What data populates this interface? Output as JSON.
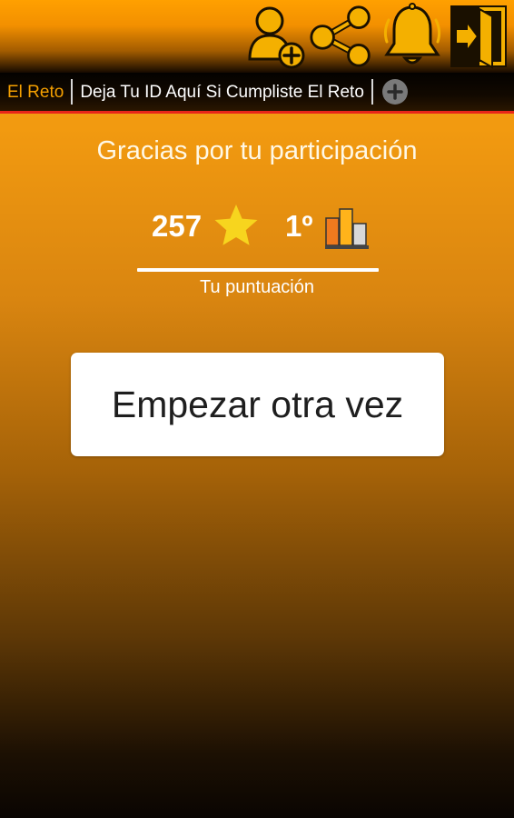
{
  "toolbar": {
    "icons": [
      "add-user-icon",
      "share-icon",
      "bell-icon",
      "exit-icon"
    ],
    "accent_color": "#f5a000"
  },
  "tabs": [
    {
      "label": "El Reto",
      "active": true
    },
    {
      "label": "Deja Tu ID Aquí Si Cumpliste El Reto",
      "active": false
    }
  ],
  "result": {
    "thanks_text": "Gracias por tu participación",
    "score": "257",
    "rank": "1º",
    "score_label": "Tu puntuación"
  },
  "actions": {
    "restart_label": "Empezar otra vez"
  }
}
